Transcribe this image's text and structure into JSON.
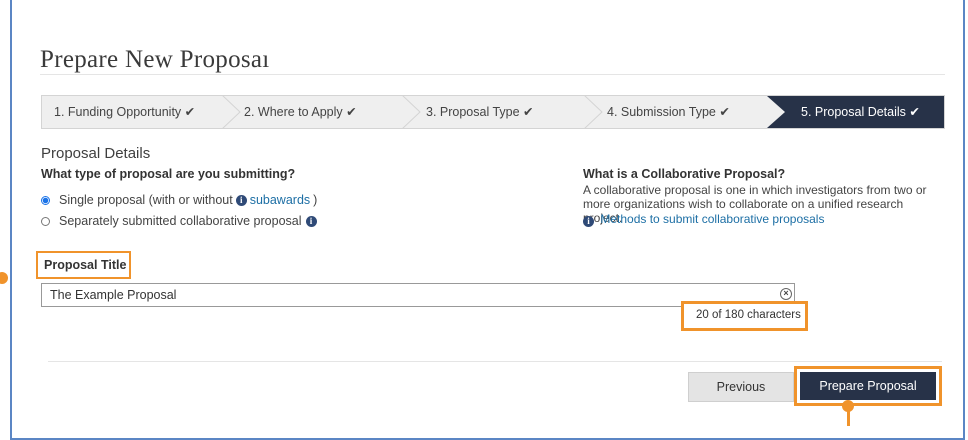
{
  "page": {
    "title": "Prepare New Proposaı"
  },
  "steps": [
    {
      "label": "1. Funding Opportunity ✔"
    },
    {
      "label": "2. Where to Apply ✔"
    },
    {
      "label": "3. Proposal Type ✔"
    },
    {
      "label": "4. Submission Type ✔"
    },
    {
      "label": "5. Proposal Details ✔"
    }
  ],
  "details": {
    "heading": "Proposal Details",
    "question": "What type of proposal are you submitting?",
    "option1_prefix": "Single proposal (with or without",
    "option1_link": "subawards",
    "option1_suffix": ")",
    "option2": "Separately submitted collaborative proposal"
  },
  "collab": {
    "heading": "What is a Collaborative Proposal?",
    "text": "A collaborative proposal is one in which investigators from two or more organizations wish to collaborate on a unified research project.",
    "link": "Methods to submit collaborative proposals"
  },
  "title_field": {
    "label": "Proposal Title",
    "value": "The Example Proposal",
    "counter": "20 of 180 characters"
  },
  "buttons": {
    "previous": "Previous",
    "prepare": "Prepare Proposal"
  },
  "icons": {
    "info": "i",
    "clear": "×"
  },
  "colors": {
    "accent": "#f0932b",
    "navy": "#273248",
    "link": "#1d6fa5"
  }
}
